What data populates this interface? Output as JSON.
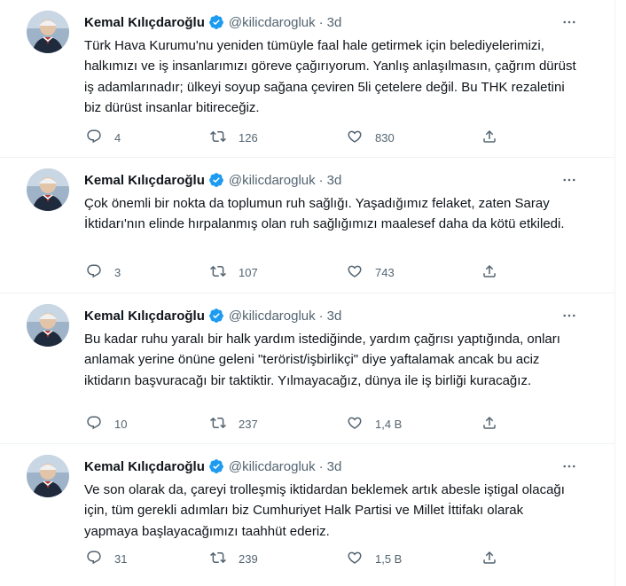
{
  "author": {
    "name": "Kemal Kılıçdaroğlu",
    "handle": "@kilicdarogluk",
    "separator": "·",
    "time": "3d"
  },
  "colors": {
    "verified": "#1d9bf0",
    "secondary_text": "#536471",
    "avatar_bg": "#9fb3c8"
  },
  "icons": {
    "verified": "verified-badge-icon",
    "more": "more-options-icon",
    "reply": "reply-icon",
    "retweet": "retweet-icon",
    "like": "like-icon",
    "share": "share-icon"
  },
  "tweets": [
    {
      "text": "Türk Hava Kurumu'nu yeniden tümüyle faal hale getirmek için belediyelerimizi, halkımızı ve iş insanlarımızı göreve çağırıyorum. Yanlış anlaşılmasın, çağrım dürüst iş adamlarınadır; ülkeyi soyup sağana çeviren 5li çetelere değil. Bu THK rezaletini biz dürüst insanlar bitireceğiz.",
      "replies": "4",
      "retweets": "126",
      "likes": "830"
    },
    {
      "text": "Çok önemli bir nokta da toplumun ruh sağlığı. Yaşadığımız felaket, zaten Saray İktidarı'nın elinde hırpalanmış olan ruh sağlığımızı maalesef daha da kötü etkiledi.",
      "replies": "3",
      "retweets": "107",
      "likes": "743"
    },
    {
      "text": "Bu kadar ruhu yaralı bir halk yardım istediğinde, yardım çağrısı yaptığında, onları anlamak yerine önüne geleni \"terörist/işbirlikçi\" diye yaftalamak ancak bu aciz iktidarın başvuracağı bir taktiktir. Yılmayacağız, dünya ile iş birliği kuracağız.",
      "replies": "10",
      "retweets": "237",
      "likes": "1,4 B"
    },
    {
      "text": "Ve son olarak da, çareyi trolleşmiş iktidardan beklemek artık abesle iştigal olacağı için, tüm gerekli adımları biz Cumhuriyet Halk Partisi ve Millet İttifakı olarak yapmaya başlayacağımızı taahhüt ederiz.",
      "replies": "31",
      "retweets": "239",
      "likes": "1,5 B"
    }
  ]
}
